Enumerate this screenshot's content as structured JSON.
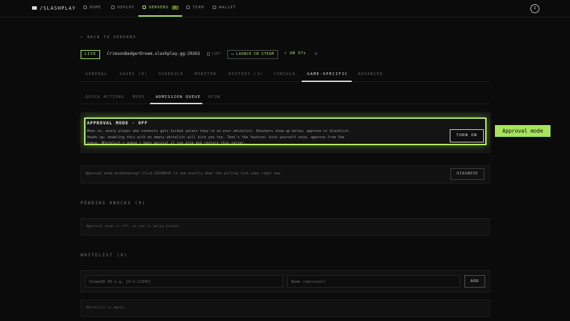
{
  "nav": {
    "brand": "/SLASHPLAY",
    "items": [
      {
        "label": "HOME",
        "icon": "home-icon"
      },
      {
        "label": "DEPLOY",
        "icon": "plus-icon"
      },
      {
        "label": "SERVERS",
        "icon": "servers-icon",
        "count": "1"
      },
      {
        "label": "TEAM",
        "icon": "team-icon"
      },
      {
        "label": "WALLET",
        "icon": "wallet-icon"
      }
    ],
    "avatar": "I"
  },
  "back_link": "BACK TO SERVERS",
  "server": {
    "status": "LIVE",
    "address": "CrimsonBadgerDream.slashplay.gg:29263",
    "copy_label": "COPY",
    "steam_label": "LAUNCH IN STEAM",
    "uptime": "ON 37s"
  },
  "tabs": [
    "GENERAL",
    "SAVES (0)",
    "SCHEDULE",
    "MONITOR",
    "HISTORY (3)",
    "CONSOLE",
    "GAME-SPECIFIC",
    "ADVANCED"
  ],
  "subtabs": [
    "QUICK ACTIONS",
    "MODS",
    "ADMISSION QUEUE",
    "RCON"
  ],
  "approval": {
    "title": "APPROVAL MODE · OFF",
    "description": "When on, every player who connects gets kicked unless they're on your whitelist. Knockers show up below; approve or blacklist. Heads up: enabling this with an empty whitelist will kick you too. That's the feature: kick yourself once, approve from the queue. Whitelist + queue + bans persist if you stop and restore this server.",
    "button": "TURN ON",
    "tag": "Approval mode"
  },
  "diagnose": {
    "text": "Approval mode misbehaving? Click DIAGNOSE to see exactly what the polling tick sees right now.",
    "button": "DIAGNOSE"
  },
  "pending": {
    "heading": "PENDING KNOCKS (0)",
    "empty": "Approval mode is off; no one is being kicked."
  },
  "whitelist": {
    "heading": "WHITELIST (0)",
    "steam_placeholder": "SteamID ID e.g. [U:1:12345]",
    "name_placeholder": "Name (optional)",
    "add_button": "ADD",
    "empty": "Whitelist is empty."
  },
  "colors": {
    "accent": "#a6e55b",
    "background": "#0b0b0b",
    "panel": "#141414"
  }
}
